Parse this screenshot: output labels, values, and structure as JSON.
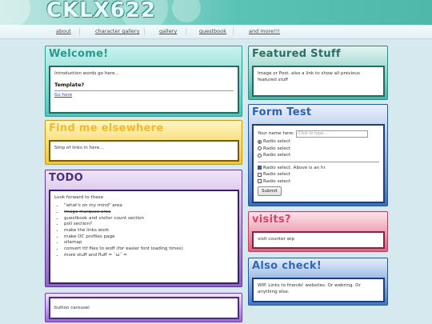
{
  "site": {
    "title": "CKLX622"
  },
  "nav": [
    "about",
    "character gallery",
    "gallery",
    "guestbook",
    "and more!!!"
  ],
  "welcome": {
    "heading": "Welcome!",
    "intro": "Introduction words go here...",
    "template_label": "Template?",
    "link": "Go here"
  },
  "find": {
    "heading": "Find me elsewhere",
    "text": "Strip of links in here..."
  },
  "todo": {
    "heading": "TODO",
    "intro": "Look forward to these",
    "items": [
      "\"what's on my mind\" area",
      "image marquee area",
      "guestbook and visitor count section",
      "poll section?",
      "make the links work",
      "make OC profiles page",
      "sitemap",
      "convert ttf files to woff (for easier font loading times)",
      "more stuff and fluff = ˘ω˘ ="
    ]
  },
  "carousel": {
    "text": "button carousel"
  },
  "featured": {
    "heading": "Featured Stuff",
    "text": "Image or Post. also a link to show all previous featured stuff"
  },
  "form": {
    "heading": "Form Test",
    "name_label": "Your name here:",
    "name_placeholder": "Click to type...",
    "radios": [
      "Radio select",
      "Radio select",
      "Radio select"
    ],
    "checks": [
      "Radio select. Above is an hr",
      "Radio select",
      "Radio select"
    ],
    "submit": "Submit"
  },
  "visits": {
    "heading": "visits?",
    "text": "visit counter wip"
  },
  "also": {
    "heading": "Also check!",
    "text": "WIP. Links to friends' websites. Or webring. Or anything else."
  },
  "colors": {
    "teal": "#3fb7a9",
    "yellow": "#f3c83a",
    "purple": "#7a4fb8",
    "blue": "#3b6fc2",
    "pink": "#e0607e"
  }
}
